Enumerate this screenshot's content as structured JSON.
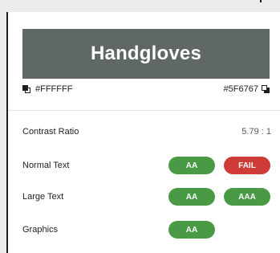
{
  "preview": {
    "sample_text": "Handgloves",
    "background_color": "#5F6767",
    "text_color": "#FFFFFF"
  },
  "swatches": {
    "foreground_label": "#FFFFFF",
    "background_label": "#5F6767"
  },
  "results": {
    "contrast_ratio_label": "Contrast Ratio",
    "contrast_ratio_value": "5.79 : 1",
    "normal_text_label": "Normal Text",
    "normal_text_aa": "AA",
    "normal_text_aaa": "FAIL",
    "large_text_label": "Large Text",
    "large_text_aa": "AA",
    "large_text_aaa": "AAA",
    "graphics_label": "Graphics",
    "graphics_aa": "AA"
  },
  "colors": {
    "pass": "#4a9a45",
    "fail": "#cf3b36",
    "panel_bg": "#ffffff",
    "chrome_bg": "#ececec"
  },
  "icons": {
    "foreground_swatch": "color-chip-icon",
    "background_swatch": "color-chip-icon"
  }
}
